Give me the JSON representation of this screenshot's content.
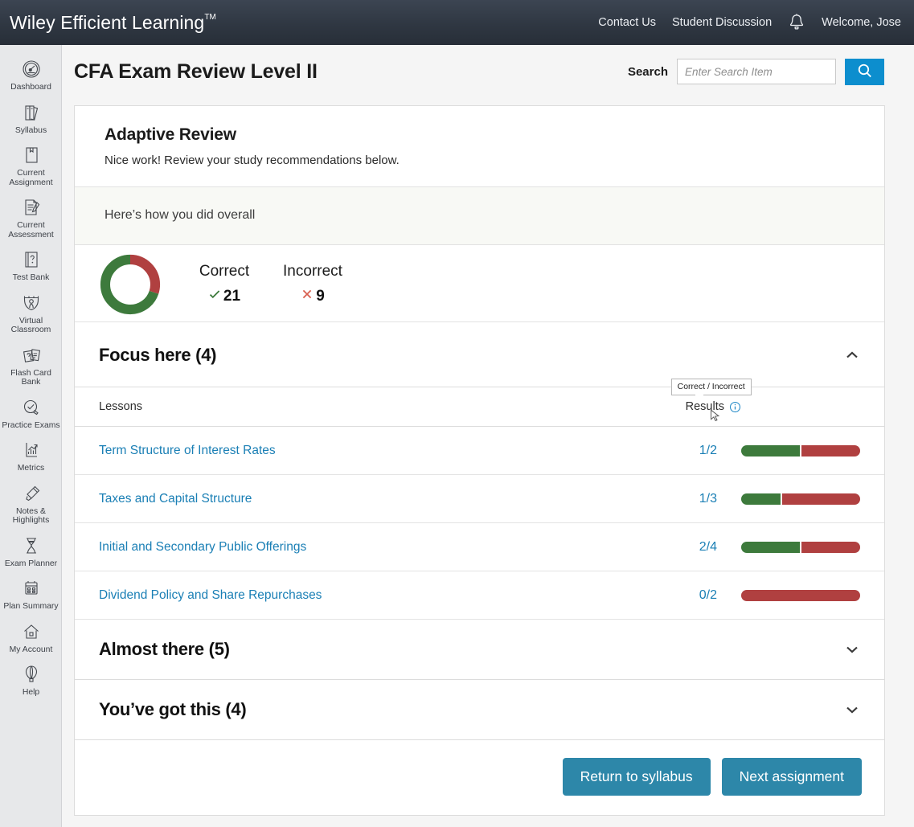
{
  "topbar": {
    "brand": "Wiley Efficient Learning",
    "brand_tm": "TM",
    "links": [
      {
        "label": "Contact Us"
      },
      {
        "label": "Student Discussion"
      }
    ],
    "bell_icon": "notification-bell-icon",
    "welcome": "Welcome, Jose"
  },
  "sidebar": {
    "items": [
      {
        "label": "Dashboard",
        "icon": "speedometer-icon"
      },
      {
        "label": "Syllabus",
        "icon": "books-icon"
      },
      {
        "label": "Current\nAssignment",
        "icon": "bookmarked-book-icon"
      },
      {
        "label": "Current\nAssessment",
        "icon": "document-pen-icon"
      },
      {
        "label": "Test Bank",
        "icon": "question-page-icon"
      },
      {
        "label": "Virtual\nClassroom",
        "icon": "classroom-person-icon"
      },
      {
        "label": "Flash Card\nBank",
        "icon": "flash-cards-icon"
      },
      {
        "label": "Practice Exams",
        "icon": "check-pencil-icon"
      },
      {
        "label": "Metrics",
        "icon": "bar-chart-icon"
      },
      {
        "label": "Notes &\nHighlights",
        "icon": "highlighter-icon"
      },
      {
        "label": "Exam Planner",
        "icon": "hourglass-icon"
      },
      {
        "label": "Plan Summary",
        "icon": "calendar-icon"
      },
      {
        "label": "My Account",
        "icon": "home-icon"
      },
      {
        "label": "Help",
        "icon": "hot-air-balloon-icon"
      }
    ]
  },
  "header": {
    "title": "CFA Exam Review Level II",
    "search_label": "Search",
    "search_value": "",
    "search_placeholder": "Enter Search Item",
    "search_icon": "search-icon"
  },
  "intro": {
    "title": "Adaptive Review",
    "subtitle": "Nice work! Review your study recommendations below."
  },
  "overall": {
    "caption": "Here’s how you did overall",
    "correct_label": "Correct",
    "incorrect_label": "Incorrect",
    "correct_value": "21",
    "incorrect_value": "9",
    "check_icon": "check-icon",
    "cross_icon": "cross-icon"
  },
  "focus": {
    "title": "Focus here (4)",
    "chevron_icon": "chevron-up-icon",
    "col_lessons": "Lessons",
    "col_results": "Results",
    "info_icon": "info-circle-icon",
    "tooltip": "Correct / Incorrect",
    "cursor_icon": "mouse-cursor-icon",
    "rows": [
      {
        "lesson": "Term Structure of Interest Rates",
        "score": "1/2"
      },
      {
        "lesson": "Taxes and Capital Structure",
        "score": "1/3"
      },
      {
        "lesson": "Initial and Secondary Public Offerings",
        "score": "2/4"
      },
      {
        "lesson": "Dividend Policy and Share Repurchases",
        "score": "0/2"
      }
    ]
  },
  "accordions": [
    {
      "title": "Almost there (5)",
      "chevron_icon": "chevron-down-icon"
    },
    {
      "title": "You’ve got this  (4)",
      "chevron_icon": "chevron-down-icon"
    }
  ],
  "footer": {
    "return_label": "Return to syllabus",
    "next_label": "Next assignment"
  },
  "colors": {
    "correct_green": "#3d7a3c",
    "incorrect_red": "#b04040",
    "link_blue": "#1a7fb5",
    "button_teal": "#2d87a9",
    "search_blue": "#0c8ece",
    "topbar_dark": "#2f3742"
  },
  "chart_data": {
    "type": "pie",
    "title": "Here’s how you did overall",
    "categories": [
      "Correct",
      "Incorrect"
    ],
    "values": [
      21,
      9
    ],
    "total": 30,
    "colors": [
      "#3d7a3c",
      "#b04040"
    ],
    "donut": true,
    "legend": "right",
    "bars": [
      {
        "label": "Term Structure of Interest Rates",
        "correct": 1,
        "total": 2
      },
      {
        "label": "Taxes and Capital Structure",
        "correct": 1,
        "total": 3
      },
      {
        "label": "Initial and Secondary Public Offerings",
        "correct": 2,
        "total": 4
      },
      {
        "label": "Dividend Policy and Share Repurchases",
        "correct": 0,
        "total": 2
      }
    ]
  }
}
